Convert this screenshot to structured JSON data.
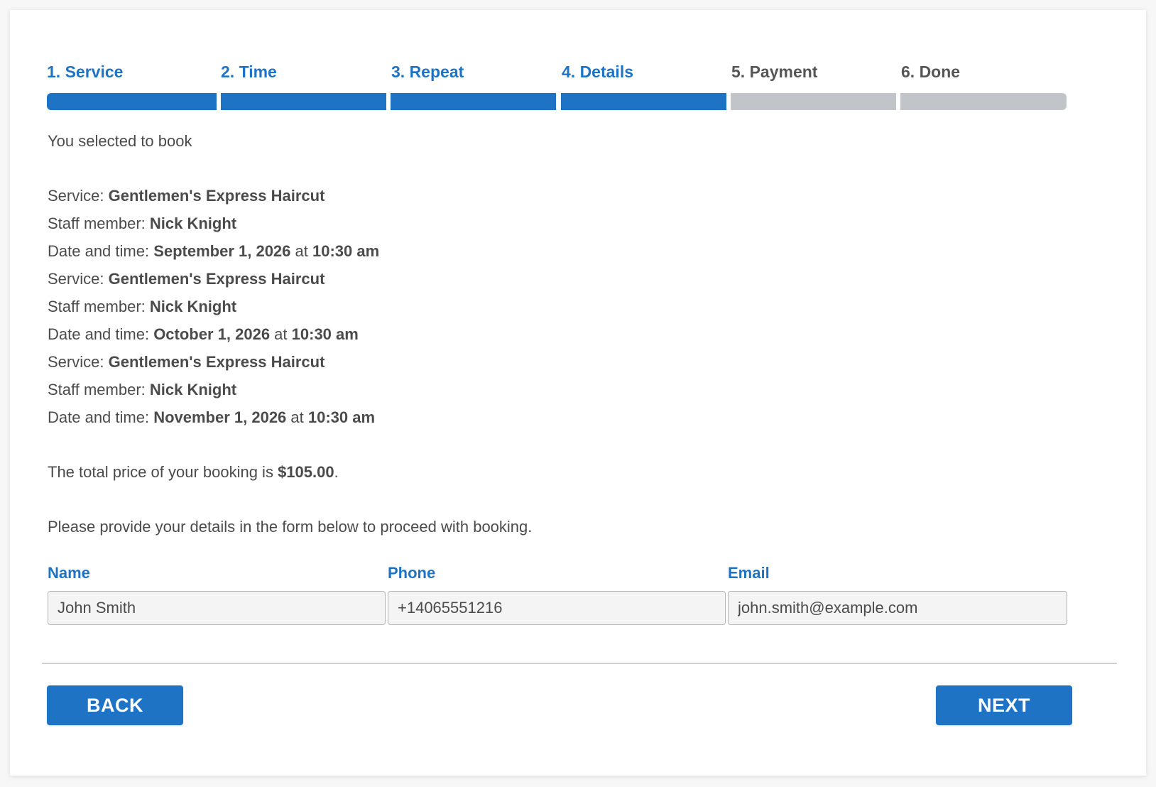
{
  "steps": [
    {
      "label": "1. Service",
      "active": true
    },
    {
      "label": "2. Time",
      "active": true
    },
    {
      "label": "3. Repeat",
      "active": true
    },
    {
      "label": "4. Details",
      "active": true
    },
    {
      "label": "5. Payment",
      "active": false
    },
    {
      "label": "6. Done",
      "active": false
    }
  ],
  "summary": {
    "intro": "You selected to book",
    "service_label": "Service: ",
    "staff_label": "Staff member: ",
    "datetime_label": "Date and time: ",
    "at_word": " at ",
    "bookings": [
      {
        "service": "Gentlemen's Express Haircut",
        "staff": "Nick Knight",
        "date": "September 1, 2026",
        "time": "10:30 am"
      },
      {
        "service": "Gentlemen's Express Haircut",
        "staff": "Nick Knight",
        "date": "October 1, 2026",
        "time": "10:30 am"
      },
      {
        "service": "Gentlemen's Express Haircut",
        "staff": "Nick Knight",
        "date": "November 1, 2026",
        "time": "10:30 am"
      }
    ],
    "total_prefix": "The total price of your booking is ",
    "total_value": "$105.00",
    "total_suffix": ".",
    "instruction": "Please provide your details in the form below to proceed with booking."
  },
  "form": {
    "name_label": "Name",
    "name_value": "John Smith",
    "phone_label": "Phone",
    "phone_value": "+14065551216",
    "email_label": "Email",
    "email_value": "john.smith@example.com"
  },
  "buttons": {
    "back_label": "BACK",
    "next_label": "NEXT"
  },
  "colors": {
    "accent": "#1f73c4",
    "inactive": "#c1c5c9",
    "text": "#4b4b4b"
  }
}
